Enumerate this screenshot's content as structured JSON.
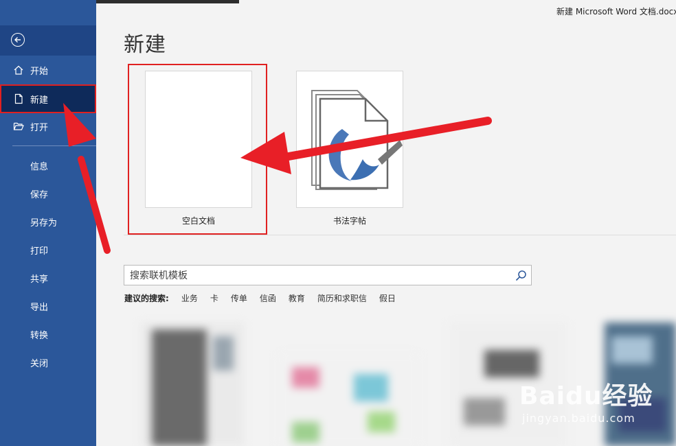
{
  "window": {
    "doc_title": "新建 Microsoft Word 文档.docx"
  },
  "sidebar": {
    "top_items": [
      {
        "label": "开始",
        "icon": "home-icon"
      },
      {
        "label": "新建",
        "icon": "new-document-icon",
        "active": true
      },
      {
        "label": "打开",
        "icon": "folder-open-icon"
      }
    ],
    "items": [
      "信息",
      "保存",
      "另存为",
      "打印",
      "共享",
      "导出",
      "转换",
      "关闭"
    ]
  },
  "main": {
    "title": "新建",
    "templates": [
      {
        "label": "空白文档",
        "highlighted": true
      },
      {
        "label": "书法字帖"
      }
    ],
    "search": {
      "placeholder": "搜索联机模板"
    },
    "suggested": {
      "label": "建议的搜索:",
      "keywords": [
        "业务",
        "卡",
        "传单",
        "信函",
        "教育",
        "简历和求职信",
        "假日"
      ]
    }
  },
  "watermark": {
    "brand": "Baidu经验",
    "url": "jingyan.baidu.com"
  },
  "colors": {
    "sidebar": "#2b579a",
    "highlight": "#e02020",
    "active_bg": "#0e2a5a"
  }
}
